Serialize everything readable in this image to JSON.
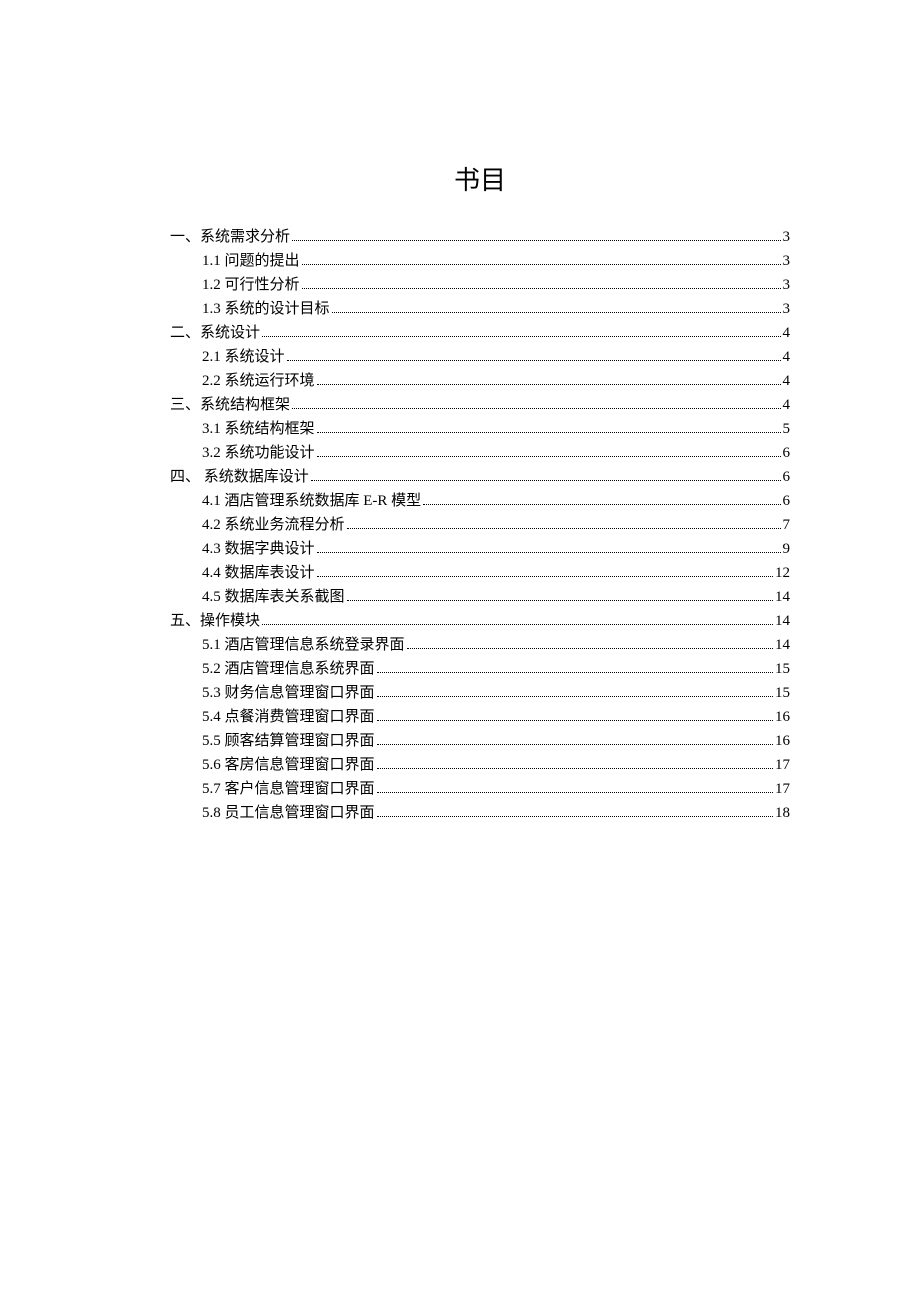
{
  "title": "书目",
  "toc": [
    {
      "level": 1,
      "label": "一、系统需求分析",
      "page": "3"
    },
    {
      "level": 2,
      "label": "1.1 问题的提出",
      "page": "3"
    },
    {
      "level": 2,
      "label": "1.2 可行性分析",
      "page": "3"
    },
    {
      "level": 2,
      "label": "1.3 系统的设计目标",
      "page": "3"
    },
    {
      "level": 1,
      "label": "二、系统设计",
      "page": "4"
    },
    {
      "level": 2,
      "label": "2.1 系统设计",
      "page": "4"
    },
    {
      "level": 2,
      "label": "2.2 系统运行环境",
      "page": "4"
    },
    {
      "level": 1,
      "label": "三、系统结构框架",
      "page": "4"
    },
    {
      "level": 2,
      "label": "3.1 系统结构框架",
      "page": "5"
    },
    {
      "level": 2,
      "label": "3.2  系统功能设计",
      "page": "6"
    },
    {
      "level": 1,
      "label": "四、 系统数据库设计",
      "page": "6"
    },
    {
      "level": 2,
      "label": "4.1 酒店管理系统数据库 E-R 模型",
      "page": "6"
    },
    {
      "level": 2,
      "label": "4.2 系统业务流程分析",
      "page": "7"
    },
    {
      "level": 2,
      "label": "4.3  数据字典设计",
      "page": "9"
    },
    {
      "level": 2,
      "label": "4.4  数据库表设计",
      "page": "12"
    },
    {
      "level": 2,
      "label": "4.5  数据库表关系截图",
      "page": "14"
    },
    {
      "level": 1,
      "label": "五、操作模块",
      "page": "14"
    },
    {
      "level": 2,
      "label": "5.1  酒店管理信息系统登录界面",
      "page": "14"
    },
    {
      "level": 2,
      "label": "5.2  酒店管理信息系统界面",
      "page": "15"
    },
    {
      "level": 2,
      "label": "5.3  财务信息管理窗口界面",
      "page": "15"
    },
    {
      "level": 2,
      "label": "5.4  点餐消费管理窗口界面",
      "page": "16"
    },
    {
      "level": 2,
      "label": "5.5  顾客结算管理窗口界面",
      "page": "16"
    },
    {
      "level": 2,
      "label": "5.6  客房信息管理窗口界面",
      "page": "17"
    },
    {
      "level": 2,
      "label": "5.7 客户信息管理窗口界面",
      "page": "17"
    },
    {
      "level": 2,
      "label": "5.8  员工信息管理窗口界面",
      "page": "18"
    }
  ]
}
